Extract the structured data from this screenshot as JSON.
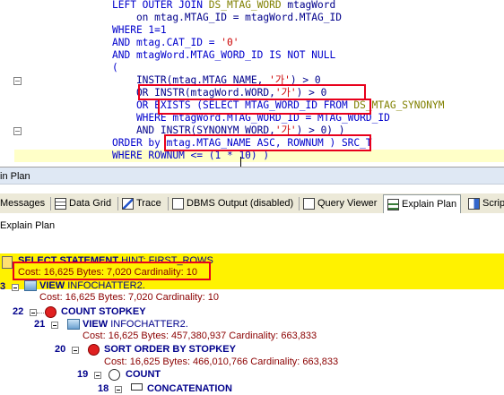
{
  "editor": {
    "lines": [
      {
        "segments": [
          {
            "t": "LEFT OUTER JOIN ",
            "c": "kw"
          },
          {
            "t": "DS_MTAG_WORD",
            "c": "tbl"
          },
          {
            "t": " mtagWord",
            "c": "id"
          }
        ]
      },
      {
        "segments": [
          {
            "t": "    on mtag.MTAG_ID = mtagWord.MTAG_ID",
            "c": "id"
          }
        ]
      },
      {
        "segments": [
          {
            "t": "WHERE 1=1",
            "c": "kw"
          }
        ]
      },
      {
        "segments": [
          {
            "t": "AND mtag.CAT_ID = ",
            "c": "kw"
          },
          {
            "t": "'0'",
            "c": "str"
          }
        ]
      },
      {
        "segments": [
          {
            "t": "AND mtagWord.MTAG_WORD_ID IS NOT NULL",
            "c": "kw"
          }
        ]
      },
      {
        "segments": [
          {
            "t": "(",
            "c": "kw"
          }
        ]
      },
      {
        "segments": [
          {
            "t": "    INSTR(mtag.MTAG_NAME, ",
            "c": "id"
          },
          {
            "t": "'가'",
            "c": "str"
          },
          {
            "t": ") > 0",
            "c": "id"
          }
        ]
      },
      {
        "segments": [
          {
            "t": "    OR INSTR(mtagWord.WORD,",
            "c": "id"
          },
          {
            "t": "'가'",
            "c": "str"
          },
          {
            "t": ") > 0",
            "c": "id"
          }
        ]
      },
      {
        "segments": [
          {
            "t": "    OR EXISTS (SELECT MTAG_WORD_ID FROM ",
            "c": "kw"
          },
          {
            "t": "DS_MTAG_SYNONYM",
            "c": "tbl"
          }
        ]
      },
      {
        "segments": [
          {
            "t": "    WHERE mtagWord.MTAG_WORD_ID = MTAG_WORD_ID",
            "c": "kw"
          }
        ]
      },
      {
        "segments": [
          {
            "t": "    AND INSTR(SYNONYM_WORD,",
            "c": "id"
          },
          {
            "t": "'가'",
            "c": "str"
          },
          {
            "t": ") > 0) )",
            "c": "id"
          }
        ]
      },
      {
        "segments": [
          {
            "t": "ORDER by mtag.MTAG_NAME ASC, ROWNUM ) SRC_T",
            "c": "kw"
          }
        ]
      },
      {
        "segments": [
          {
            "t": "WHERE ROWNUM <= (1 * 10) )",
            "c": "kw"
          }
        ]
      }
    ]
  },
  "panel_title": "in Plan",
  "tabs": [
    {
      "label": "Messages",
      "icon": "messages-icon",
      "active": false
    },
    {
      "label": "Data Grid",
      "icon": "data-grid-icon",
      "active": false
    },
    {
      "label": "Trace",
      "icon": "trace-icon",
      "active": false
    },
    {
      "label": "DBMS Output (disabled)",
      "icon": "dbms-output-icon",
      "active": false
    },
    {
      "label": "Query Viewer",
      "icon": "query-viewer-icon",
      "active": false
    },
    {
      "label": "Explain Plan",
      "icon": "explain-plan-icon",
      "active": true
    },
    {
      "label": "Scrip",
      "icon": "script-icon",
      "active": false
    }
  ],
  "subbar_label": "Explain Plan",
  "plan": {
    "root": {
      "op": "SELECT STATEMENT",
      "hint": "HINT: FIRST_ROWS",
      "cost": "Cost: 16,625  Bytes: 7,020  Cardinality: 10"
    },
    "rows": [
      {
        "id": "3",
        "op": "VIEW",
        "obj": "INFOCHATTER2.",
        "cost": "Cost: 16,625  Bytes: 7,020  Cardinality: 10"
      },
      {
        "id": "22",
        "op": "COUNT STOPKEY",
        "obj": "",
        "cost": ""
      },
      {
        "id": "21",
        "op": "VIEW",
        "obj": "INFOCHATTER2.",
        "cost": "Cost: 16,625  Bytes: 457,380,937  Cardinality: 663,833"
      },
      {
        "id": "20",
        "op": "SORT ORDER BY STOPKEY",
        "obj": "",
        "cost": "Cost: 16,625  Bytes: 466,010,766  Cardinality: 663,833"
      },
      {
        "id": "19",
        "op": "COUNT",
        "obj": "",
        "cost": ""
      },
      {
        "id": "18",
        "op": "CONCATENATION",
        "obj": "",
        "cost": ""
      }
    ]
  },
  "colors": {
    "highlight": "#fff200",
    "annotation": "#e8001c"
  }
}
